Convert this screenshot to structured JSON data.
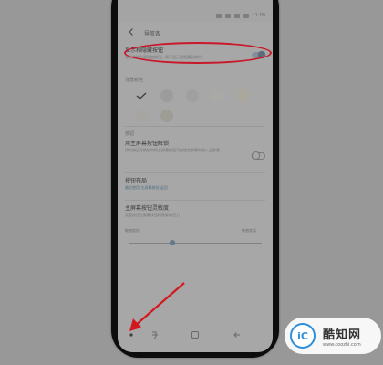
{
  "status_bar": {
    "time": "11:09"
  },
  "header": {
    "title": "导航条"
  },
  "toggle_row": {
    "title": "显示和隐藏按钮",
    "description": "在导航栏左侧添加按钮，用于显示或隐藏导航栏。",
    "enabled": true
  },
  "background_color": {
    "label": "背景颜色",
    "swatches": [
      "#858585",
      "#9c9c9c",
      "#a0a0a0",
      "#a9a9a5",
      "#aaa89d",
      "#a6a5a1",
      "#9f9c95"
    ],
    "selected_index": 0
  },
  "buttons_section": {
    "label": "按钮",
    "home_unlock": {
      "title": "用主屏幕按钮解锁",
      "description": "用力按压导航栏中的主屏幕按钮可在锁定屏幕时进入主屏幕",
      "enabled": false
    },
    "layout": {
      "title": "按钮布局",
      "value": "最近使用-主屏幕按钮-返回"
    },
    "sensitivity": {
      "title": "主屏幕按钮灵敏度",
      "description": "设置按压主屏幕按钮时需要的压力",
      "min_label": "敏感度低",
      "max_label": "敏感度高",
      "level": 0.33
    }
  },
  "watermark": {
    "title": "酷知网",
    "url": "www.coozhi.com",
    "logo": "iC"
  }
}
